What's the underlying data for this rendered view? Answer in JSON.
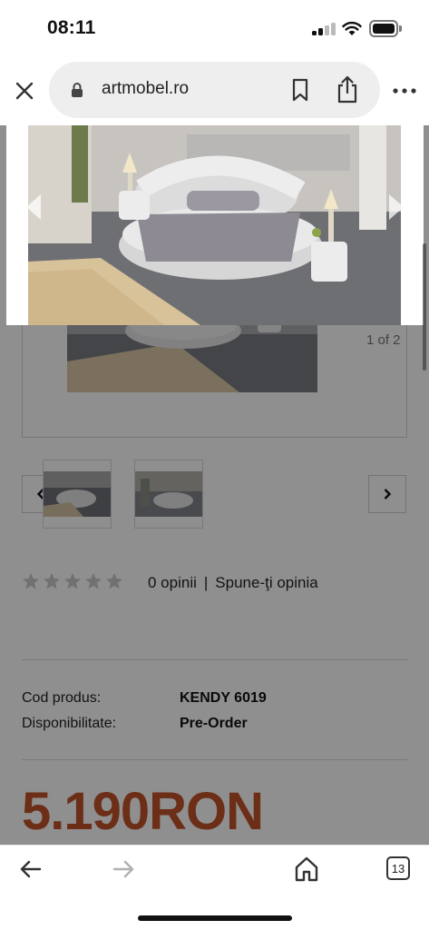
{
  "status_bar": {
    "time": "08:11"
  },
  "browser": {
    "url": "artmobel.ro",
    "tab_count": "13"
  },
  "gallery": {
    "counter": "1 of 2"
  },
  "rating": {
    "stars_filled": 0,
    "stars_total": 5,
    "reviews_text": "0 opinii",
    "separator": "|",
    "write_review": "Spune-ţi opinia"
  },
  "product": {
    "code_label": "Cod produs:",
    "code_value": "KENDY 6019",
    "availability_label": "Disponibilitate:",
    "availability_value": "Pre-Order",
    "price": "5.190RON"
  },
  "colors": {
    "price": "#c0522a",
    "overlay": "rgba(0,0,0,0.44)"
  },
  "icons": [
    "close-icon",
    "lock-icon",
    "bookmark-icon",
    "share-icon",
    "more-icon",
    "chevron-left-icon",
    "chevron-right-icon",
    "star-icon",
    "back-arrow-icon",
    "forward-arrow-icon",
    "home-icon",
    "tabs-icon"
  ]
}
